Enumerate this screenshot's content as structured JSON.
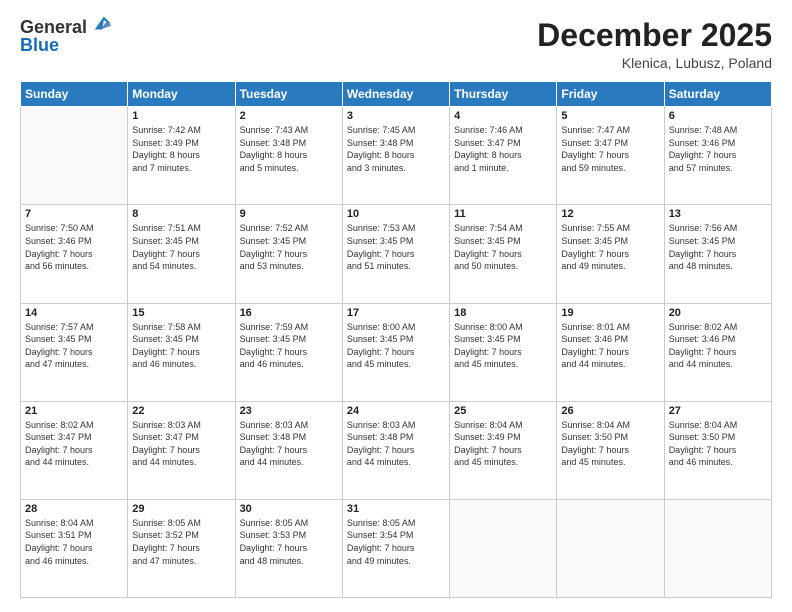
{
  "logo": {
    "general": "General",
    "blue": "Blue"
  },
  "header": {
    "month": "December 2025",
    "location": "Klenica, Lubusz, Poland"
  },
  "weekdays": [
    "Sunday",
    "Monday",
    "Tuesday",
    "Wednesday",
    "Thursday",
    "Friday",
    "Saturday"
  ],
  "weeks": [
    [
      {
        "day": "",
        "info": ""
      },
      {
        "day": "1",
        "info": "Sunrise: 7:42 AM\nSunset: 3:49 PM\nDaylight: 8 hours\nand 7 minutes."
      },
      {
        "day": "2",
        "info": "Sunrise: 7:43 AM\nSunset: 3:48 PM\nDaylight: 8 hours\nand 5 minutes."
      },
      {
        "day": "3",
        "info": "Sunrise: 7:45 AM\nSunset: 3:48 PM\nDaylight: 8 hours\nand 3 minutes."
      },
      {
        "day": "4",
        "info": "Sunrise: 7:46 AM\nSunset: 3:47 PM\nDaylight: 8 hours\nand 1 minute."
      },
      {
        "day": "5",
        "info": "Sunrise: 7:47 AM\nSunset: 3:47 PM\nDaylight: 7 hours\nand 59 minutes."
      },
      {
        "day": "6",
        "info": "Sunrise: 7:48 AM\nSunset: 3:46 PM\nDaylight: 7 hours\nand 57 minutes."
      }
    ],
    [
      {
        "day": "7",
        "info": "Sunrise: 7:50 AM\nSunset: 3:46 PM\nDaylight: 7 hours\nand 56 minutes."
      },
      {
        "day": "8",
        "info": "Sunrise: 7:51 AM\nSunset: 3:45 PM\nDaylight: 7 hours\nand 54 minutes."
      },
      {
        "day": "9",
        "info": "Sunrise: 7:52 AM\nSunset: 3:45 PM\nDaylight: 7 hours\nand 53 minutes."
      },
      {
        "day": "10",
        "info": "Sunrise: 7:53 AM\nSunset: 3:45 PM\nDaylight: 7 hours\nand 51 minutes."
      },
      {
        "day": "11",
        "info": "Sunrise: 7:54 AM\nSunset: 3:45 PM\nDaylight: 7 hours\nand 50 minutes."
      },
      {
        "day": "12",
        "info": "Sunrise: 7:55 AM\nSunset: 3:45 PM\nDaylight: 7 hours\nand 49 minutes."
      },
      {
        "day": "13",
        "info": "Sunrise: 7:56 AM\nSunset: 3:45 PM\nDaylight: 7 hours\nand 48 minutes."
      }
    ],
    [
      {
        "day": "14",
        "info": "Sunrise: 7:57 AM\nSunset: 3:45 PM\nDaylight: 7 hours\nand 47 minutes."
      },
      {
        "day": "15",
        "info": "Sunrise: 7:58 AM\nSunset: 3:45 PM\nDaylight: 7 hours\nand 46 minutes."
      },
      {
        "day": "16",
        "info": "Sunrise: 7:59 AM\nSunset: 3:45 PM\nDaylight: 7 hours\nand 46 minutes."
      },
      {
        "day": "17",
        "info": "Sunrise: 8:00 AM\nSunset: 3:45 PM\nDaylight: 7 hours\nand 45 minutes."
      },
      {
        "day": "18",
        "info": "Sunrise: 8:00 AM\nSunset: 3:45 PM\nDaylight: 7 hours\nand 45 minutes."
      },
      {
        "day": "19",
        "info": "Sunrise: 8:01 AM\nSunset: 3:46 PM\nDaylight: 7 hours\nand 44 minutes."
      },
      {
        "day": "20",
        "info": "Sunrise: 8:02 AM\nSunset: 3:46 PM\nDaylight: 7 hours\nand 44 minutes."
      }
    ],
    [
      {
        "day": "21",
        "info": "Sunrise: 8:02 AM\nSunset: 3:47 PM\nDaylight: 7 hours\nand 44 minutes."
      },
      {
        "day": "22",
        "info": "Sunrise: 8:03 AM\nSunset: 3:47 PM\nDaylight: 7 hours\nand 44 minutes."
      },
      {
        "day": "23",
        "info": "Sunrise: 8:03 AM\nSunset: 3:48 PM\nDaylight: 7 hours\nand 44 minutes."
      },
      {
        "day": "24",
        "info": "Sunrise: 8:03 AM\nSunset: 3:48 PM\nDaylight: 7 hours\nand 44 minutes."
      },
      {
        "day": "25",
        "info": "Sunrise: 8:04 AM\nSunset: 3:49 PM\nDaylight: 7 hours\nand 45 minutes."
      },
      {
        "day": "26",
        "info": "Sunrise: 8:04 AM\nSunset: 3:50 PM\nDaylight: 7 hours\nand 45 minutes."
      },
      {
        "day": "27",
        "info": "Sunrise: 8:04 AM\nSunset: 3:50 PM\nDaylight: 7 hours\nand 46 minutes."
      }
    ],
    [
      {
        "day": "28",
        "info": "Sunrise: 8:04 AM\nSunset: 3:51 PM\nDaylight: 7 hours\nand 46 minutes."
      },
      {
        "day": "29",
        "info": "Sunrise: 8:05 AM\nSunset: 3:52 PM\nDaylight: 7 hours\nand 47 minutes."
      },
      {
        "day": "30",
        "info": "Sunrise: 8:05 AM\nSunset: 3:53 PM\nDaylight: 7 hours\nand 48 minutes."
      },
      {
        "day": "31",
        "info": "Sunrise: 8:05 AM\nSunset: 3:54 PM\nDaylight: 7 hours\nand 49 minutes."
      },
      {
        "day": "",
        "info": ""
      },
      {
        "day": "",
        "info": ""
      },
      {
        "day": "",
        "info": ""
      }
    ]
  ]
}
